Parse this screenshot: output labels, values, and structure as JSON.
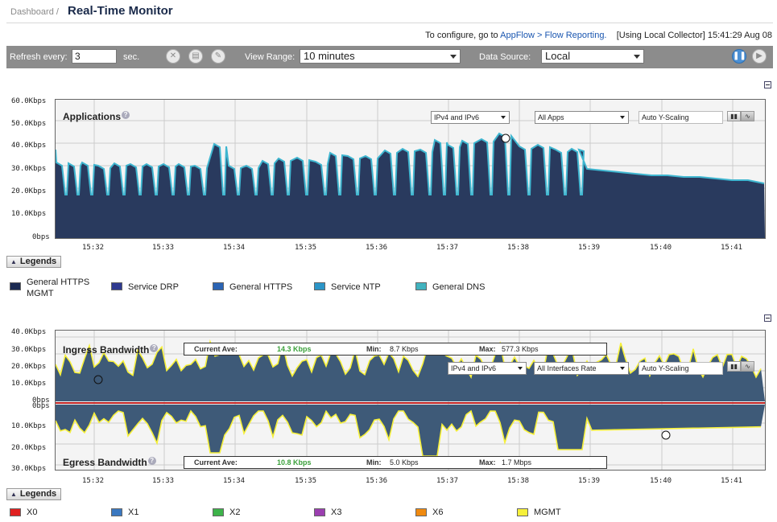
{
  "breadcrumb": "Dashboard /",
  "title": "Real-Time Monitor",
  "info": {
    "prefix": "To configure, go to ",
    "link": "AppFlow > Flow Reporting.",
    "collector": "[Using Local Collector]",
    "time": "15:41:29 Aug 08"
  },
  "toolbar": {
    "refresh_label": "Refresh every:",
    "refresh_value": "3",
    "refresh_unit": "sec.",
    "view_range_label": "View Range:",
    "view_range_value": "10 minutes",
    "data_source_label": "Data Source:",
    "data_source_value": "Local"
  },
  "x_ticks": [
    "15:32",
    "15:33",
    "15:34",
    "15:35",
    "15:36",
    "15:37",
    "15:38",
    "15:39",
    "15:40",
    "15:41"
  ],
  "apps_chart": {
    "title": "Applications",
    "ip_select": "IPv4 and IPv6",
    "apps_select": "All Apps",
    "scaling": "Auto Y-Scaling",
    "y_ticks": [
      "60.0Kbps",
      "50.0Kbps",
      "40.0Kbps",
      "30.0Kbps",
      "20.0Kbps",
      "10.0Kbps",
      "0bps"
    ]
  },
  "apps_legend": {
    "button": "Legends",
    "items": [
      {
        "label": "General HTTPS MGMT",
        "color": "#1b2a52"
      },
      {
        "label": "Service DRP",
        "color": "#2f3a90"
      },
      {
        "label": "General HTTPS",
        "color": "#2b64b4"
      },
      {
        "label": "Service NTP",
        "color": "#2b95c8"
      },
      {
        "label": "General DNS",
        "color": "#41b3bf"
      }
    ]
  },
  "bw_chart": {
    "ingress_title": "Ingress Bandwidth",
    "egress_title": "Egress Bandwidth",
    "ip_select": "IPv4 and IPv6",
    "iface_select": "All Interfaces Rate",
    "scaling": "Auto Y-Scaling",
    "y_ticks_top": [
      "40.0Kbps",
      "30.0Kbps",
      "20.0Kbps",
      "10.0Kbps",
      "0bps"
    ],
    "y_ticks_bottom": [
      "0bps",
      "10.0Kbps",
      "20.0Kbps",
      "30.0Kbps"
    ],
    "ingress_stats": {
      "cur_label": "Current Ave:",
      "cur": "14.3 Kbps",
      "min_label": "Min:",
      "min": "8.7 Kbps",
      "max_label": "Max:",
      "max": "577.3 Kbps"
    },
    "egress_stats": {
      "cur_label": "Current Ave:",
      "cur": "10.8 Kbps",
      "min_label": "Min:",
      "min": "5.0 Kbps",
      "max_label": "Max:",
      "max": "1.7 Mbps"
    }
  },
  "bw_legend": {
    "button": "Legends",
    "items": [
      {
        "label": "X0",
        "color": "#e02020"
      },
      {
        "label": "X1",
        "color": "#3a78c0"
      },
      {
        "label": "X2",
        "color": "#3db34a"
      },
      {
        "label": "X3",
        "color": "#9b3fb0"
      },
      {
        "label": "X6",
        "color": "#f08a10"
      },
      {
        "label": "MGMT",
        "color": "#f6f03a"
      }
    ]
  }
}
